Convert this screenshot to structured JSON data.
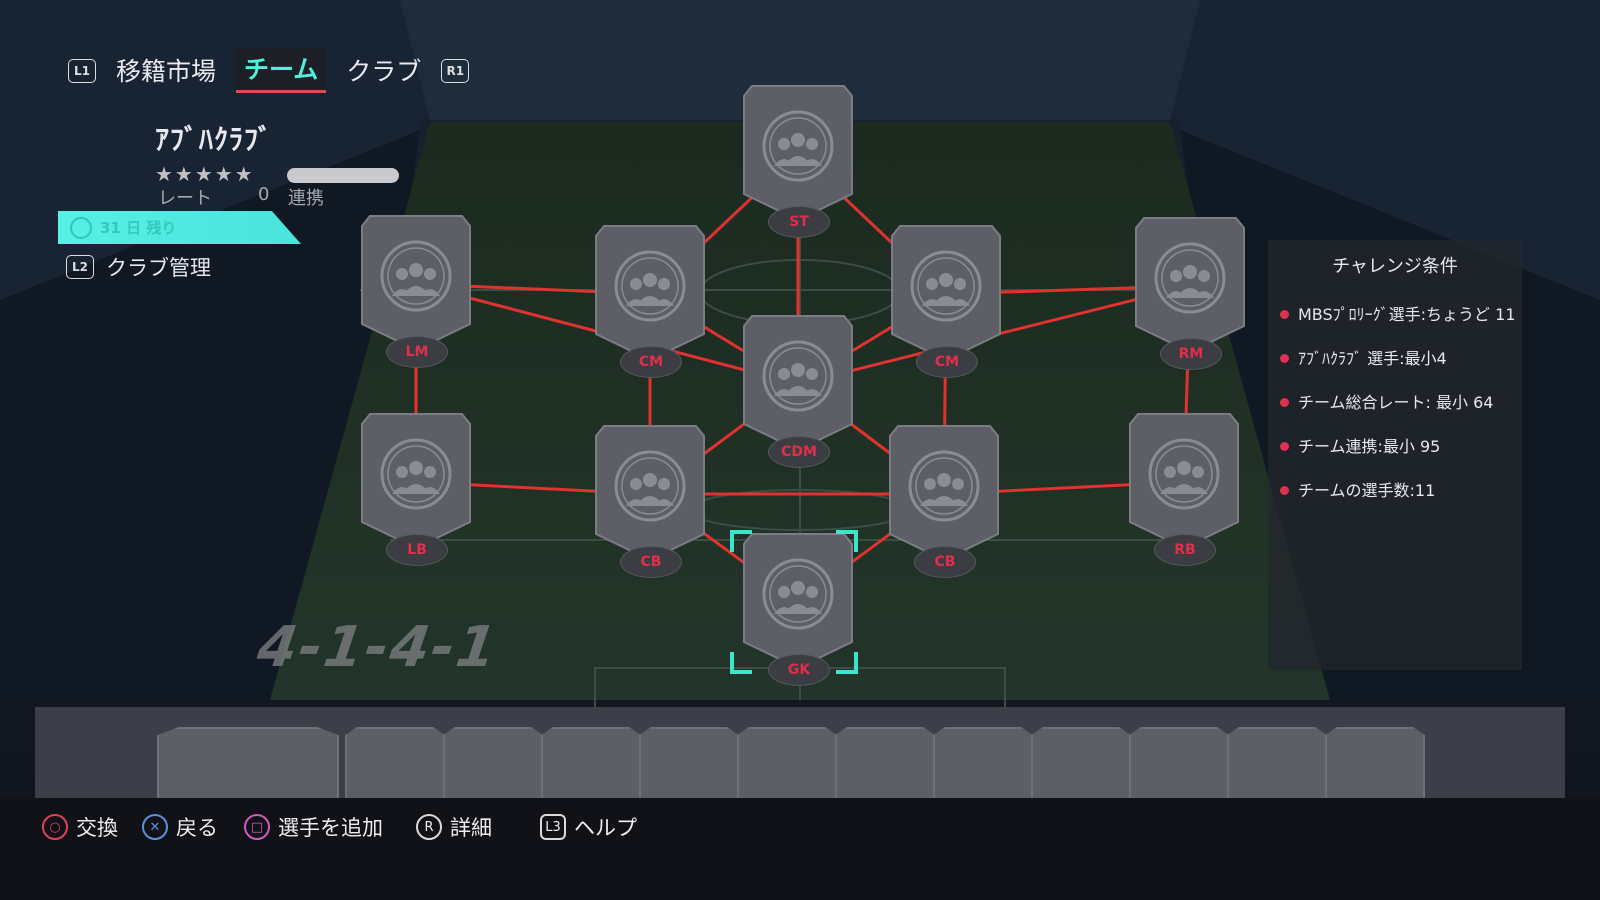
{
  "nav": {
    "left_shoulder": "L1",
    "right_shoulder": "R1",
    "tabs": [
      "移籍市場",
      "チーム",
      "クラブ"
    ],
    "active_tab": "チーム"
  },
  "club": {
    "name": "ｱﾌﾞﾊｸﾗﾌﾞ",
    "stars": "★★★★★",
    "rating_label": "レート",
    "rating_value": "0",
    "chemistry_label": "連携",
    "timer_text": "31 日 残り",
    "manage_button": "L2",
    "manage_label": "クラブ管理"
  },
  "formation": "4-1-4-1",
  "players": [
    {
      "pos": "ST"
    },
    {
      "pos": "LM"
    },
    {
      "pos": "CM"
    },
    {
      "pos": "CM"
    },
    {
      "pos": "RM"
    },
    {
      "pos": "CDM"
    },
    {
      "pos": "LB"
    },
    {
      "pos": "CB"
    },
    {
      "pos": "CB"
    },
    {
      "pos": "RB"
    },
    {
      "pos": "GK"
    }
  ],
  "challenge": {
    "title": "チャレンジ条件",
    "items": [
      "MBSﾌﾟﾛﾘｰｸﾞ選手:ちょうど 11",
      "ｱﾌﾞﾊｸﾗﾌﾞ 選手:最小4",
      "チーム総合レート: 最小 64",
      "チーム連携:最小 95",
      "チームの選手数:11"
    ]
  },
  "footer": {
    "swap": "交換",
    "back": "戻る",
    "add": "選手を追加",
    "detail": "詳細",
    "help": "ヘルプ",
    "detail_key": "R",
    "help_key": "L3"
  },
  "colors": {
    "accent": "#4ff0dd",
    "link_line": "#e0322e",
    "position_text": "#e02f4a",
    "card": "#5d5f67"
  }
}
